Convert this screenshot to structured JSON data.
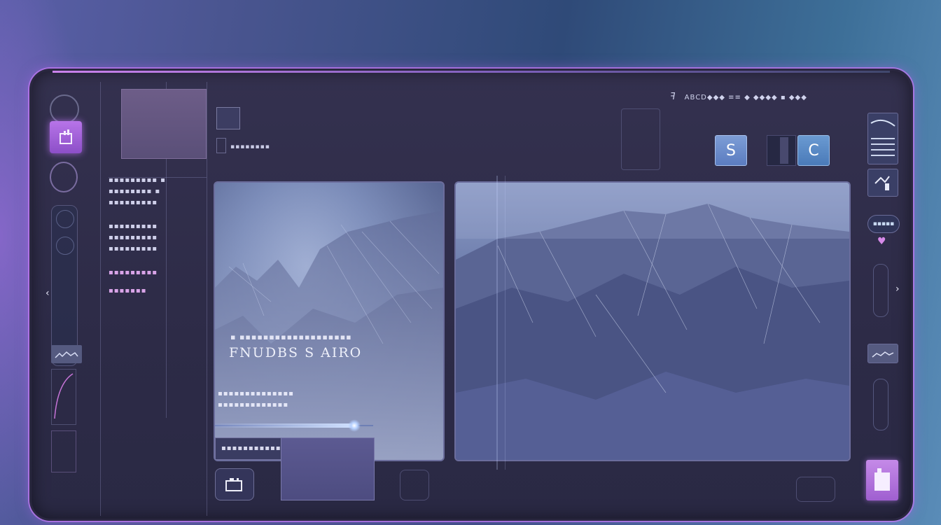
{
  "menu": {
    "items": [
      "▪▪▪▪▪▪▪▪▪ ▪",
      "▪▪▪▪▪▪▪▪ ▪",
      "▪▪▪▪▪▪▪▪▪",
      "▪▪▪▪▪▪▪▪▪",
      "▪▪▪▪▪▪▪▪▪",
      "▪▪▪▪▪▪▪▪▪",
      "▪▪▪▪▪▪▪▪▪",
      "▪▪▪▪▪▪▪"
    ]
  },
  "top": {
    "status": "ABCD◆◆◆ ≡≡ ◆ ◆◆◆◆ ▪ ◆◆◆",
    "title_glyph": "ꟻ",
    "thumb_label": "▪▪▪▪▪▪▪▪"
  },
  "panel": {
    "small_label": "▪ ▪▪▪▪▪▪▪▪▪▪▪▪▪▪▪▪▪▪▪",
    "title": "FNUDBS S AIRO",
    "sub1": "▪▪▪▪▪▪▪▪▪▪▪▪▪▪",
    "sub2": "▪▪▪▪▪▪▪▪▪▪▪▪▪",
    "row_label": "▪▪▪▪▪▪▪▪▪▪▪▪▪"
  },
  "player": {
    "progress": 0.88
  },
  "buttons": {
    "s_label": "S",
    "c_label": "C"
  },
  "rail_right": {
    "pill_label": "▪▪▪▪▪"
  },
  "colors": {
    "accent_purple": "#b774e8",
    "accent_blue": "#5b7cc0",
    "frame": "#2d2b47"
  },
  "icons": {
    "left_rail": [
      "ring-icon",
      "home-icon",
      "circle-icon",
      "chevron-left-icon",
      "wave-icon"
    ],
    "right_rail": [
      "image-icon",
      "pin-icon",
      "heart-icon",
      "chevron-right-icon",
      "user-icon"
    ],
    "bottom": [
      "camera-icon"
    ]
  }
}
